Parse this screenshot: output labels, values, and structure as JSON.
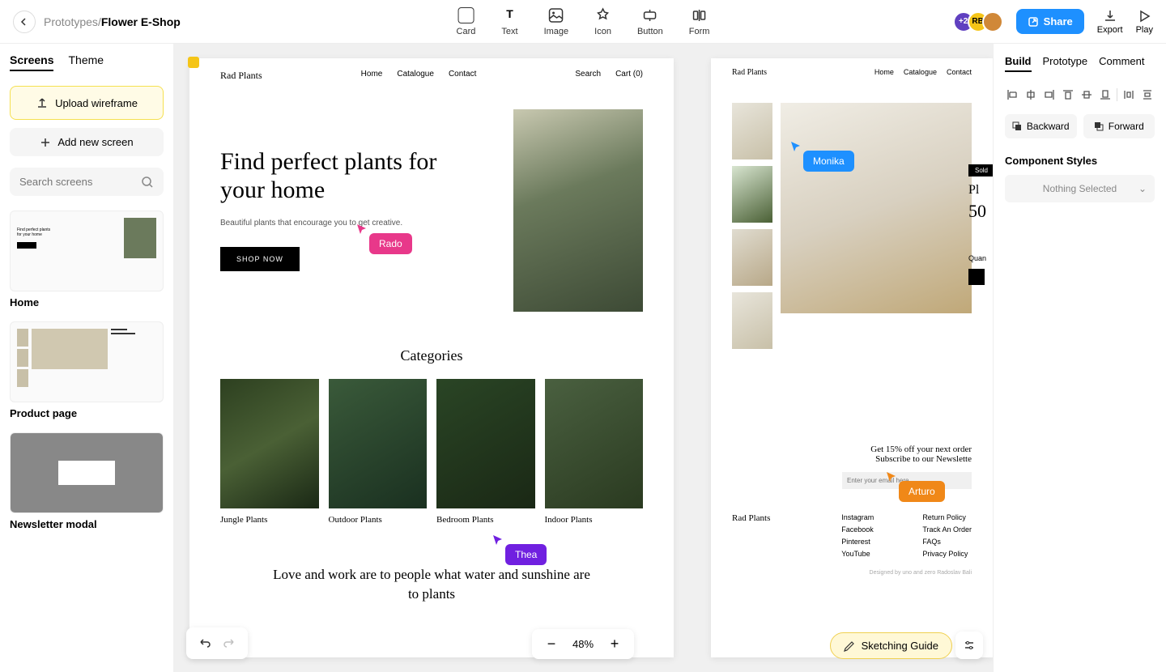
{
  "breadcrumb": {
    "parent": "Prototypes",
    "current": "Flower E-Shop"
  },
  "tools": {
    "card": "Card",
    "text": "Text",
    "image": "Image",
    "icon": "Icon",
    "button": "Button",
    "form": "Form"
  },
  "topbar": {
    "plus_count": "+2",
    "avatar2": "RB",
    "share": "Share",
    "export": "Export",
    "play": "Play"
  },
  "sidebar": {
    "tabs": {
      "screens": "Screens",
      "theme": "Theme"
    },
    "upload": "Upload wireframe",
    "add_screen": "Add new screen",
    "search_placeholder": "Search screens",
    "screens": [
      "Home",
      "Product page",
      "Newsletter modal"
    ]
  },
  "artboard1": {
    "logo": "Rad Plants",
    "nav": [
      "Home",
      "Catalogue",
      "Contact"
    ],
    "search": "Search",
    "cart": "Cart (0)",
    "hero_title": "Find perfect plants for your home",
    "hero_sub": "Beautiful plants that encourage you to get creative.",
    "shop_btn": "SHOP NOW",
    "cats_title": "Categories",
    "cats": [
      "Jungle Plants",
      "Outdoor Plants",
      "Bedroom Plants",
      "Indoor Plants"
    ],
    "quote": "Love and work are to people what water and sunshine are to plants"
  },
  "artboard2": {
    "logo": "Rad Plants",
    "nav": [
      "Home",
      "Catalogue",
      "Contact"
    ],
    "badge": "Sold",
    "product_title": "Pl",
    "price_prefix": "50",
    "qty": "Quan",
    "newsletter1": "Get 15% off your next order",
    "newsletter2": "Subscribe to our Newslette",
    "email_placeholder": "Enter your email here",
    "footer_logo": "Rad Plants",
    "col1_title": "",
    "col1": [
      "Instagram",
      "Facebook",
      "Pinterest",
      "YouTube"
    ],
    "col2_title": "",
    "col2": [
      "Return Policy",
      "Track An Order",
      "FAQs",
      "Privacy Policy"
    ],
    "credit": "Designed by uno and zero Radoslav Bali"
  },
  "cursors": {
    "rado": "Rado",
    "monika": "Monika",
    "thea": "Thea",
    "arturo": "Arturo"
  },
  "zoom": "48%",
  "sketching_guide": "Sketching Guide",
  "right_panel": {
    "tabs": {
      "build": "Build",
      "prototype": "Prototype",
      "comment": "Comment"
    },
    "backward": "Backward",
    "forward": "Forward",
    "styles_title": "Component Styles",
    "styles_value": "Nothing Selected"
  }
}
